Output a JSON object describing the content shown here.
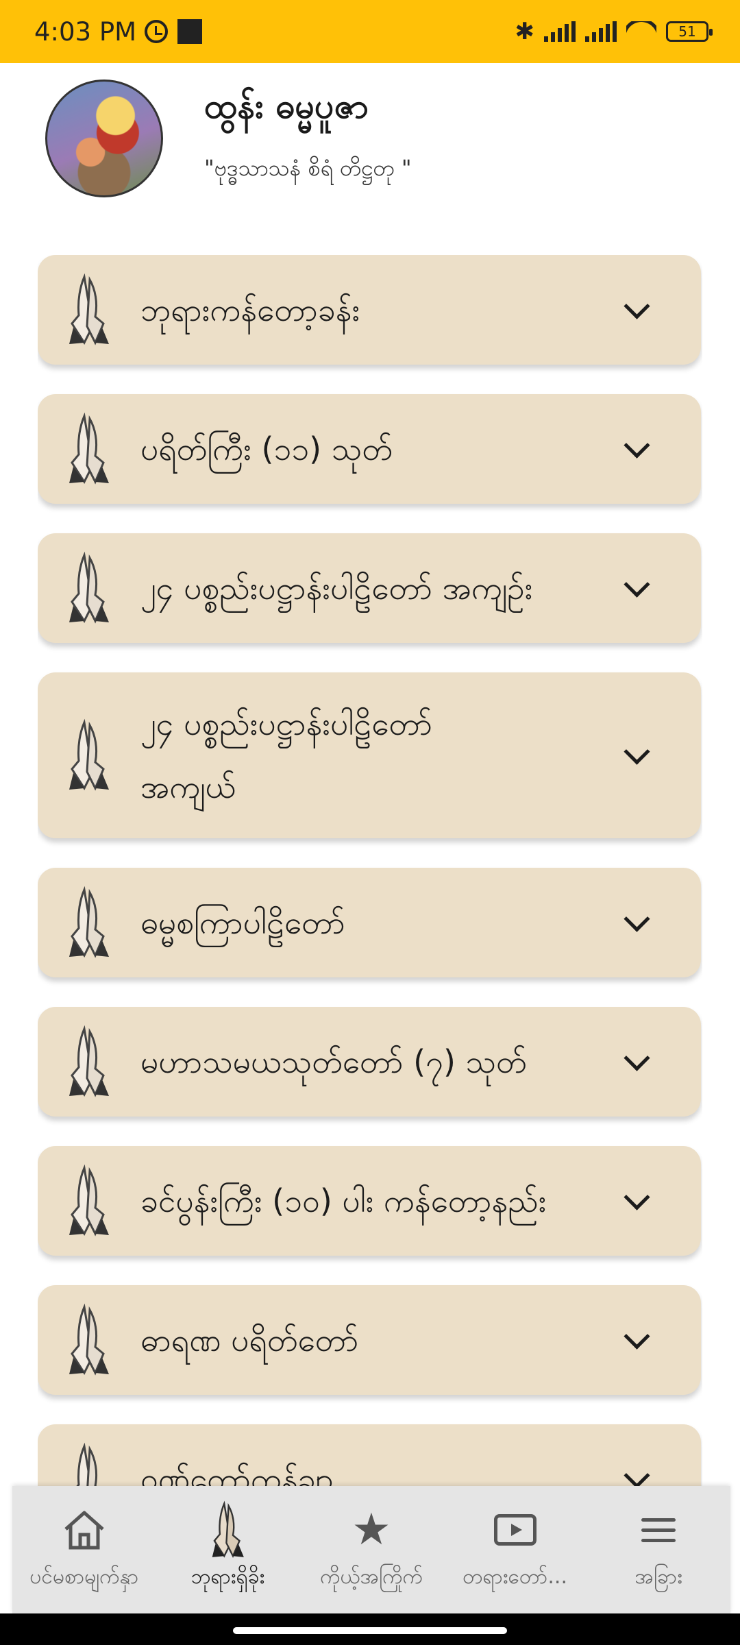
{
  "status_bar": {
    "time": "4:03 PM",
    "battery": "51",
    "icons": [
      "alarm-icon",
      "notification-square-icon",
      "bluetooth-icon",
      "signal-icon",
      "signal-icon",
      "wifi-icon",
      "battery-icon"
    ]
  },
  "header": {
    "title": "ထွန်း ဓမ္မပူဇာ",
    "subtitle": "\"ဗုဒ္ဓသာသနံ စိရံ တိဋ္ဌတု \"",
    "avatar_icon": "buddha-image"
  },
  "categories": [
    {
      "label": "ဘုရားကန်တော့ခန်း"
    },
    {
      "label": "ပရိတ်ကြီး (၁၁) သုတ်"
    },
    {
      "label": "၂၄ ပစ္စည်းပဋ္ဌာန်းပါဠိတော် အကျဉ်း"
    },
    {
      "label": "၂၄ ပစ္စည်းပဋ္ဌာန်းပါဠိတော်\nအကျယ်"
    },
    {
      "label": "ဓမ္မစကြာပါဠိတော်"
    },
    {
      "label": "မဟာသမယသုတ်တော် (၇) သုတ်"
    },
    {
      "label": "ခင်ပွန်းကြီး (၁၀) ပါး ကန်တော့နည်း"
    },
    {
      "label": "ဓာရဏ ပရိတ်တော်"
    },
    {
      "label": "ဝဏ်တော်ကန်ချာ"
    }
  ],
  "bottom_nav": {
    "items": [
      {
        "label": "ပင်မစာမျက်နှာ",
        "icon": "home-icon"
      },
      {
        "label": "ဘုရားရှိခိုး",
        "icon": "praying-hands-icon"
      },
      {
        "label": "ကိုယ့်အကြိုက်",
        "icon": "star-icon"
      },
      {
        "label": "တရားတော်...",
        "icon": "play-icon"
      },
      {
        "label": "အခြား",
        "icon": "menu-icon"
      }
    ],
    "active": "ဘုရားရှိခိုး"
  }
}
